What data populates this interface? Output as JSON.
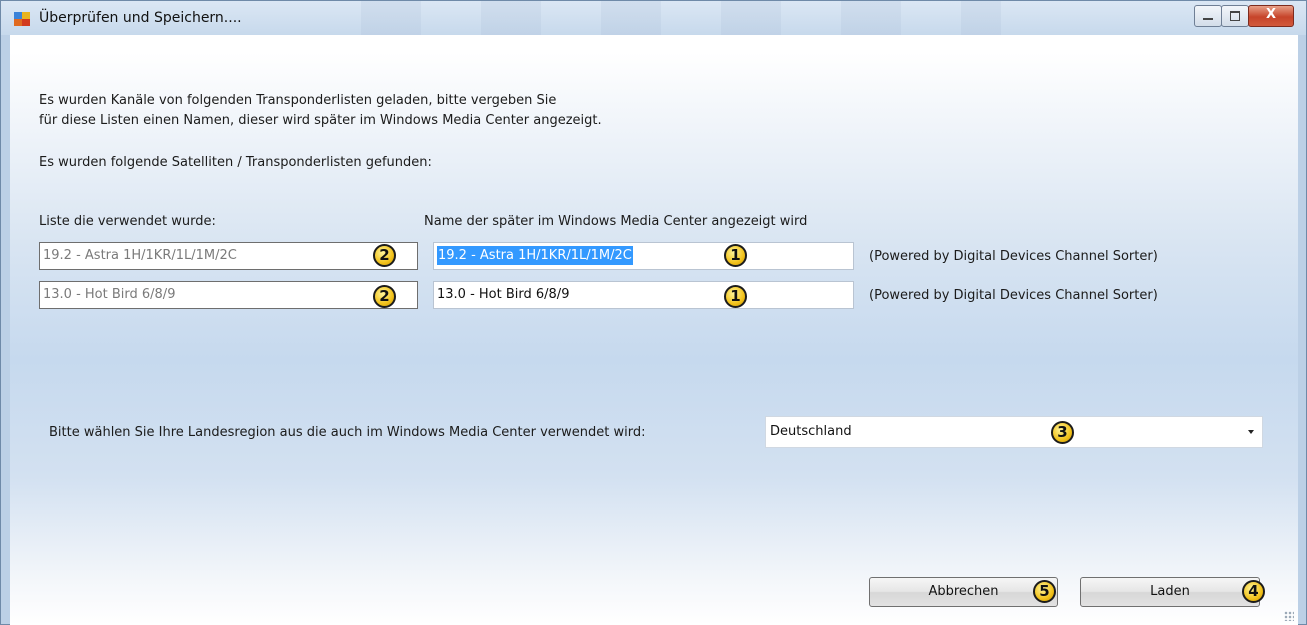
{
  "window": {
    "title": "Überprüfen und Speichern....",
    "close_glyph": "X"
  },
  "intro": {
    "line1": "Es wurden Kanäle von folgenden Transponderlisten geladen, bitte vergeben Sie",
    "line2": "für diese Listen einen Namen, dieser wird später im Windows Media Center angezeigt.",
    "found": "Es wurden folgende Satelliten / Transponderlisten gefunden:"
  },
  "columns": {
    "left_header": "Liste die verwendet wurde:",
    "right_header": "Name der später im Windows Media Center angezeigt wird"
  },
  "rows": [
    {
      "source": "19.2 - Astra 1H/1KR/1L/1M/2C",
      "name": "19.2 - Astra 1H/1KR/1L/1M/2C",
      "note": "(Powered by Digital Devices Channel Sorter)",
      "source_badge": "2",
      "name_badge": "1"
    },
    {
      "source": "13.0 - Hot Bird 6/8/9",
      "name": "13.0 - Hot Bird 6/8/9",
      "note": "(Powered by Digital Devices Channel Sorter)",
      "source_badge": "2",
      "name_badge": "1"
    }
  ],
  "region": {
    "label": "Bitte wählen Sie Ihre Landesregion aus die auch im Windows Media Center verwendet wird:",
    "selected": "Deutschland",
    "badge": "3"
  },
  "buttons": {
    "cancel": "Abbrechen",
    "cancel_badge": "5",
    "load": "Laden",
    "load_badge": "4"
  },
  "colors": {
    "selection": "#3399ff",
    "badge_fill": "#f2c21b",
    "close_button": "#c6442a"
  }
}
